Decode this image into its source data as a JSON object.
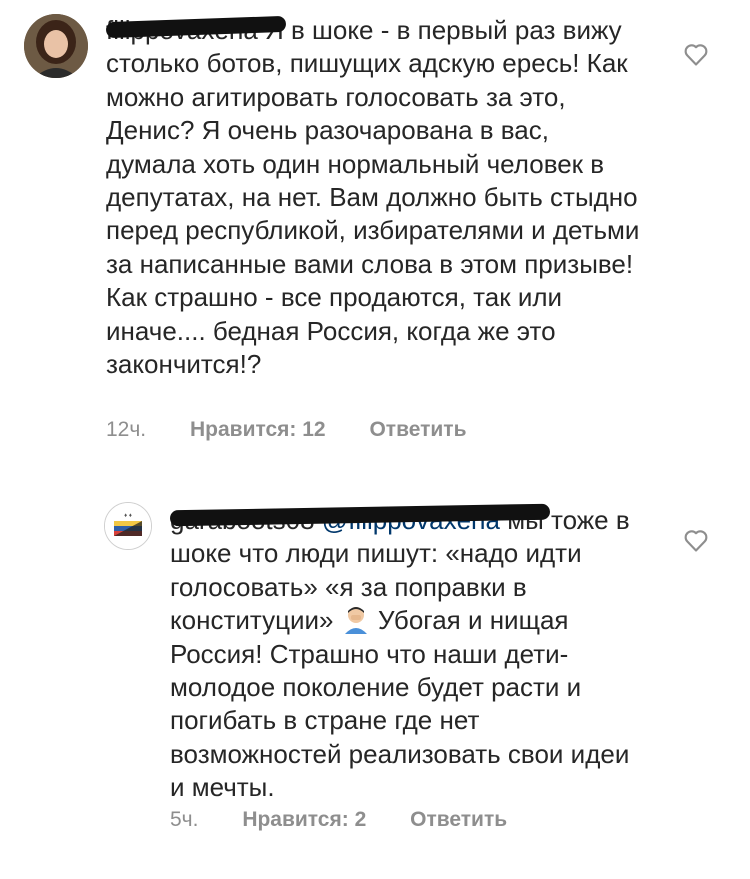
{
  "comments": [
    {
      "username": "filippovaxena",
      "text": "Я в шоке - в первый раз вижу столько ботов, пишущих адскую ересь! Как можно агитировать голосовать за это, Денис? Я очень разочарована в вас, думала хоть один нормальный человек в депутатах, на нет. Вам должно быть стыдно перед республикой, избирателями и детьми за написанные вами слова в этом призыве! Как страшно - все продаются, так или иначе.... бедная Россия, когда же это закончится!?",
      "time": "12ч.",
      "likes": "Нравится: 12",
      "reply": "Ответить",
      "like_icon": "heart-outline-icon"
    },
    {
      "username": "garaboots08",
      "mention": "@filippovaxena",
      "text_before_emoji": "мы тоже в шоке что люди пишут: «надо идти голосовать» «я за поправки в конституции»",
      "emoji": "man-facepalming-emoji",
      "text_after_emoji": "Убогая и нищая Россия! Страшно что наши дети-молодое поколение будет расти и погибать в стране где нет возможностей реализовать свои идеи и мечты.",
      "time": "5ч.",
      "likes": "Нравится: 2",
      "reply": "Ответить",
      "like_icon": "heart-outline-icon"
    }
  ]
}
